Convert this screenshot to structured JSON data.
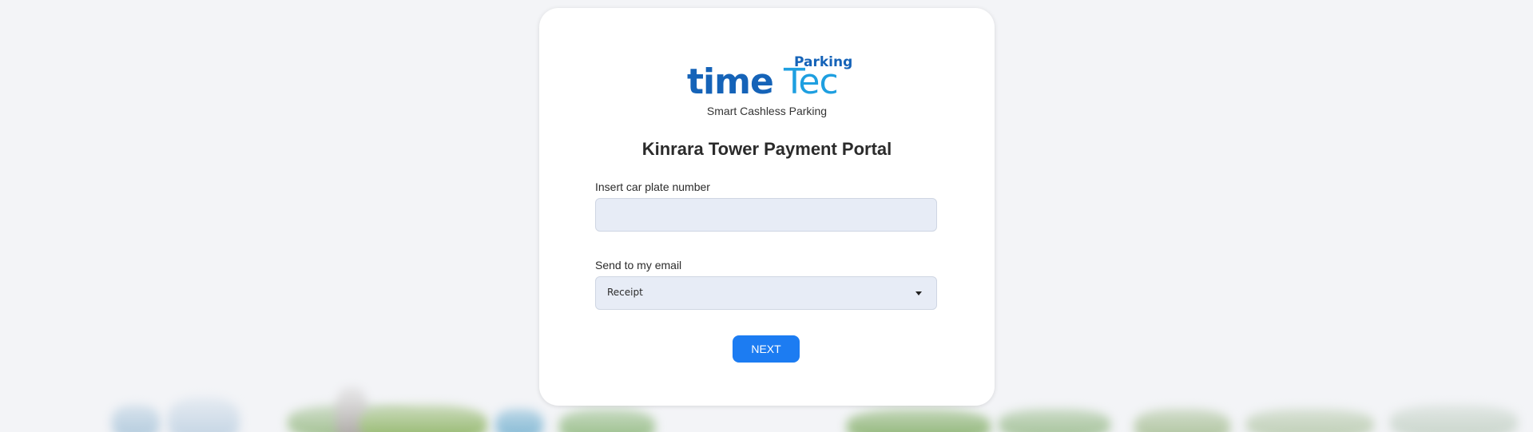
{
  "logo": {
    "word_time": "time",
    "word_tec": "Tec",
    "word_parking": "Parking",
    "tagline": "Smart Cashless Parking"
  },
  "page": {
    "title": "Kinrara Tower Payment Portal"
  },
  "form": {
    "plate_label": "Insert car plate number",
    "plate_value": "",
    "email_label": "Send to my email",
    "email_option_selected": "Receipt",
    "next_label": "NEXT"
  },
  "colors": {
    "brand_dark_blue": "#1563b8",
    "brand_light_blue": "#1e9fe0",
    "button_blue": "#1c7cf2",
    "input_fill": "#e7ecf6"
  },
  "icons": {
    "dropdown": "caret-down-icon"
  }
}
